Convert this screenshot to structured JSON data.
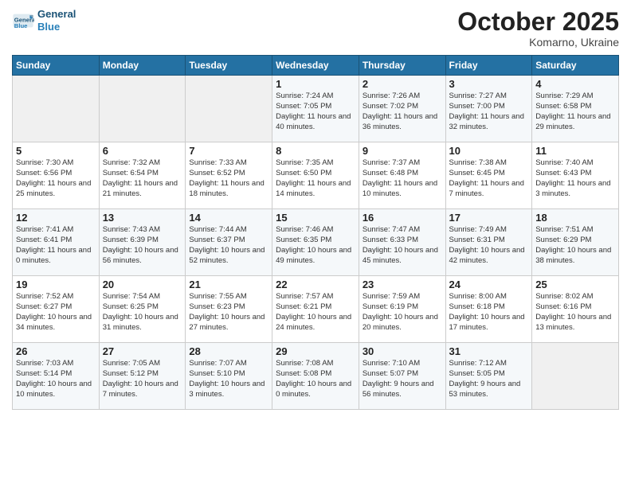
{
  "header": {
    "logo_general": "General",
    "logo_blue": "Blue",
    "month_title": "October 2025",
    "location": "Komarno, Ukraine"
  },
  "weekdays": [
    "Sunday",
    "Monday",
    "Tuesday",
    "Wednesday",
    "Thursday",
    "Friday",
    "Saturday"
  ],
  "weeks": [
    [
      {
        "day": "",
        "info": ""
      },
      {
        "day": "",
        "info": ""
      },
      {
        "day": "",
        "info": ""
      },
      {
        "day": "1",
        "info": "Sunrise: 7:24 AM\nSunset: 7:05 PM\nDaylight: 11 hours and 40 minutes."
      },
      {
        "day": "2",
        "info": "Sunrise: 7:26 AM\nSunset: 7:02 PM\nDaylight: 11 hours and 36 minutes."
      },
      {
        "day": "3",
        "info": "Sunrise: 7:27 AM\nSunset: 7:00 PM\nDaylight: 11 hours and 32 minutes."
      },
      {
        "day": "4",
        "info": "Sunrise: 7:29 AM\nSunset: 6:58 PM\nDaylight: 11 hours and 29 minutes."
      }
    ],
    [
      {
        "day": "5",
        "info": "Sunrise: 7:30 AM\nSunset: 6:56 PM\nDaylight: 11 hours and 25 minutes."
      },
      {
        "day": "6",
        "info": "Sunrise: 7:32 AM\nSunset: 6:54 PM\nDaylight: 11 hours and 21 minutes."
      },
      {
        "day": "7",
        "info": "Sunrise: 7:33 AM\nSunset: 6:52 PM\nDaylight: 11 hours and 18 minutes."
      },
      {
        "day": "8",
        "info": "Sunrise: 7:35 AM\nSunset: 6:50 PM\nDaylight: 11 hours and 14 minutes."
      },
      {
        "day": "9",
        "info": "Sunrise: 7:37 AM\nSunset: 6:48 PM\nDaylight: 11 hours and 10 minutes."
      },
      {
        "day": "10",
        "info": "Sunrise: 7:38 AM\nSunset: 6:45 PM\nDaylight: 11 hours and 7 minutes."
      },
      {
        "day": "11",
        "info": "Sunrise: 7:40 AM\nSunset: 6:43 PM\nDaylight: 11 hours and 3 minutes."
      }
    ],
    [
      {
        "day": "12",
        "info": "Sunrise: 7:41 AM\nSunset: 6:41 PM\nDaylight: 11 hours and 0 minutes."
      },
      {
        "day": "13",
        "info": "Sunrise: 7:43 AM\nSunset: 6:39 PM\nDaylight: 10 hours and 56 minutes."
      },
      {
        "day": "14",
        "info": "Sunrise: 7:44 AM\nSunset: 6:37 PM\nDaylight: 10 hours and 52 minutes."
      },
      {
        "day": "15",
        "info": "Sunrise: 7:46 AM\nSunset: 6:35 PM\nDaylight: 10 hours and 49 minutes."
      },
      {
        "day": "16",
        "info": "Sunrise: 7:47 AM\nSunset: 6:33 PM\nDaylight: 10 hours and 45 minutes."
      },
      {
        "day": "17",
        "info": "Sunrise: 7:49 AM\nSunset: 6:31 PM\nDaylight: 10 hours and 42 minutes."
      },
      {
        "day": "18",
        "info": "Sunrise: 7:51 AM\nSunset: 6:29 PM\nDaylight: 10 hours and 38 minutes."
      }
    ],
    [
      {
        "day": "19",
        "info": "Sunrise: 7:52 AM\nSunset: 6:27 PM\nDaylight: 10 hours and 34 minutes."
      },
      {
        "day": "20",
        "info": "Sunrise: 7:54 AM\nSunset: 6:25 PM\nDaylight: 10 hours and 31 minutes."
      },
      {
        "day": "21",
        "info": "Sunrise: 7:55 AM\nSunset: 6:23 PM\nDaylight: 10 hours and 27 minutes."
      },
      {
        "day": "22",
        "info": "Sunrise: 7:57 AM\nSunset: 6:21 PM\nDaylight: 10 hours and 24 minutes."
      },
      {
        "day": "23",
        "info": "Sunrise: 7:59 AM\nSunset: 6:19 PM\nDaylight: 10 hours and 20 minutes."
      },
      {
        "day": "24",
        "info": "Sunrise: 8:00 AM\nSunset: 6:18 PM\nDaylight: 10 hours and 17 minutes."
      },
      {
        "day": "25",
        "info": "Sunrise: 8:02 AM\nSunset: 6:16 PM\nDaylight: 10 hours and 13 minutes."
      }
    ],
    [
      {
        "day": "26",
        "info": "Sunrise: 7:03 AM\nSunset: 5:14 PM\nDaylight: 10 hours and 10 minutes."
      },
      {
        "day": "27",
        "info": "Sunrise: 7:05 AM\nSunset: 5:12 PM\nDaylight: 10 hours and 7 minutes."
      },
      {
        "day": "28",
        "info": "Sunrise: 7:07 AM\nSunset: 5:10 PM\nDaylight: 10 hours and 3 minutes."
      },
      {
        "day": "29",
        "info": "Sunrise: 7:08 AM\nSunset: 5:08 PM\nDaylight: 10 hours and 0 minutes."
      },
      {
        "day": "30",
        "info": "Sunrise: 7:10 AM\nSunset: 5:07 PM\nDaylight: 9 hours and 56 minutes."
      },
      {
        "day": "31",
        "info": "Sunrise: 7:12 AM\nSunset: 5:05 PM\nDaylight: 9 hours and 53 minutes."
      },
      {
        "day": "",
        "info": ""
      }
    ]
  ]
}
